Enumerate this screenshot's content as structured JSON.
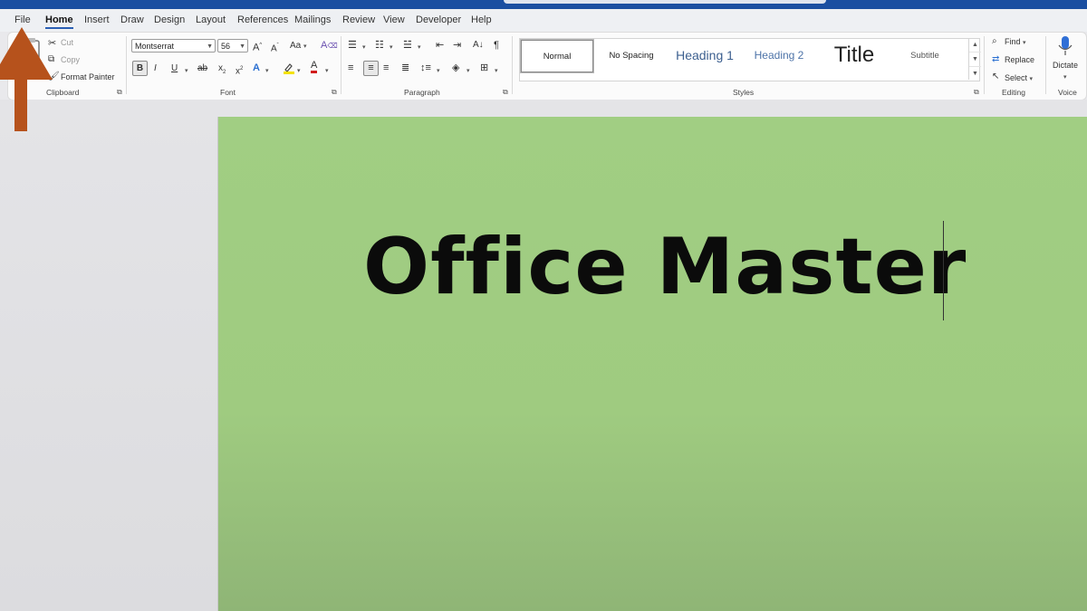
{
  "tabs": [
    "File",
    "Home",
    "Insert",
    "Draw",
    "Design",
    "Layout",
    "References",
    "Mailings",
    "Review",
    "View",
    "Developer",
    "Help"
  ],
  "active_tab": "Home",
  "clipboard": {
    "cut": "Cut",
    "copy": "Copy",
    "format_painter": "Format Painter",
    "label": "Clipboard"
  },
  "font": {
    "name": "Montserrat",
    "size": "56",
    "label": "Font",
    "grow": "A",
    "shrink": "A",
    "change_case": "Aa",
    "bold": "B",
    "italic": "I",
    "underline": "U",
    "strike": "ab",
    "subscript": "x",
    "superscript": "x"
  },
  "paragraph": {
    "label": "Paragraph",
    "pilcrow": "¶"
  },
  "styles": {
    "label": "Styles",
    "items": [
      "Normal",
      "No Spacing",
      "Heading 1",
      "Heading 2",
      "Title",
      "Subtitle"
    ]
  },
  "editing": {
    "find": "Find",
    "replace": "Replace",
    "select": "Select",
    "label": "Editing"
  },
  "voice": {
    "dictate": "Dictate",
    "label": "Voice"
  },
  "document": {
    "text": "Office Master"
  },
  "colors": {
    "accent_bar": "#1b4fa1",
    "page_green": "#a1ce83",
    "arrow": "#b6521c",
    "font_color": "#d11b1b",
    "highlight": "#f4e200"
  }
}
